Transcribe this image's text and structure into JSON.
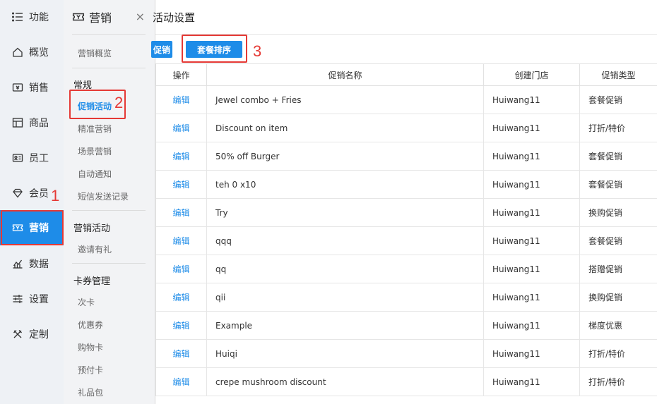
{
  "nav": {
    "items": [
      {
        "label": "功能",
        "icon": "menu-list-icon"
      },
      {
        "label": "概览",
        "icon": "home-icon"
      },
      {
        "label": "销售",
        "icon": "cash-register-icon"
      },
      {
        "label": "商品",
        "icon": "shop-icon"
      },
      {
        "label": "员工",
        "icon": "id-card-icon"
      },
      {
        "label": "会员",
        "icon": "diamond-icon"
      },
      {
        "label": "营销",
        "icon": "coupon-icon"
      },
      {
        "label": "数据",
        "icon": "chart-icon"
      },
      {
        "label": "设置",
        "icon": "sliders-icon"
      },
      {
        "label": "定制",
        "icon": "tools-icon"
      }
    ],
    "active": "营销"
  },
  "submenu": {
    "title": "营销",
    "close": "×",
    "overview": "营销概览",
    "groups": [
      {
        "title": "常规",
        "items": [
          "促销活动",
          "精准营销",
          "场景营销",
          "自动通知",
          "短信发送记录"
        ]
      },
      {
        "title": "营销活动",
        "items": [
          "邀请有礼"
        ]
      },
      {
        "title": "卡券管理",
        "items": [
          "次卡",
          "优惠券",
          "购物卡",
          "预付卡",
          "礼品包"
        ]
      }
    ],
    "active_item": "促销活动"
  },
  "main": {
    "title": "活动设置",
    "buttons": {
      "promo": "促销",
      "sort": "套餐排序"
    },
    "table": {
      "headers": [
        "操作",
        "促销名称",
        "创建门店",
        "促销类型"
      ],
      "edit_label": "编辑",
      "rows": [
        {
          "name": "Jewel combo + Fries",
          "store": "Huiwang11",
          "type": "套餐促销"
        },
        {
          "name": "Discount on item",
          "store": "Huiwang11",
          "type": "打折/特价"
        },
        {
          "name": "50% off Burger",
          "store": "Huiwang11",
          "type": "套餐促销"
        },
        {
          "name": "teh 0 x10",
          "store": "Huiwang11",
          "type": "套餐促销"
        },
        {
          "name": "Try",
          "store": "Huiwang11",
          "type": "换购促销"
        },
        {
          "name": "qqq",
          "store": "Huiwang11",
          "type": "套餐促销"
        },
        {
          "name": "qq",
          "store": "Huiwang11",
          "type": "搭赠促销"
        },
        {
          "name": "qii",
          "store": "Huiwang11",
          "type": "换购促销"
        },
        {
          "name": "Example",
          "store": "Huiwang11",
          "type": "梯度优惠"
        },
        {
          "name": "Huiqi",
          "store": "Huiwang11",
          "type": "打折/特价"
        },
        {
          "name": "crepe mushroom discount",
          "store": "Huiwang11",
          "type": "打折/特价"
        }
      ]
    }
  },
  "annotations": [
    "1",
    "2",
    "3"
  ],
  "colors": {
    "accent": "#1e8ce8",
    "annotation": "#e53935"
  }
}
